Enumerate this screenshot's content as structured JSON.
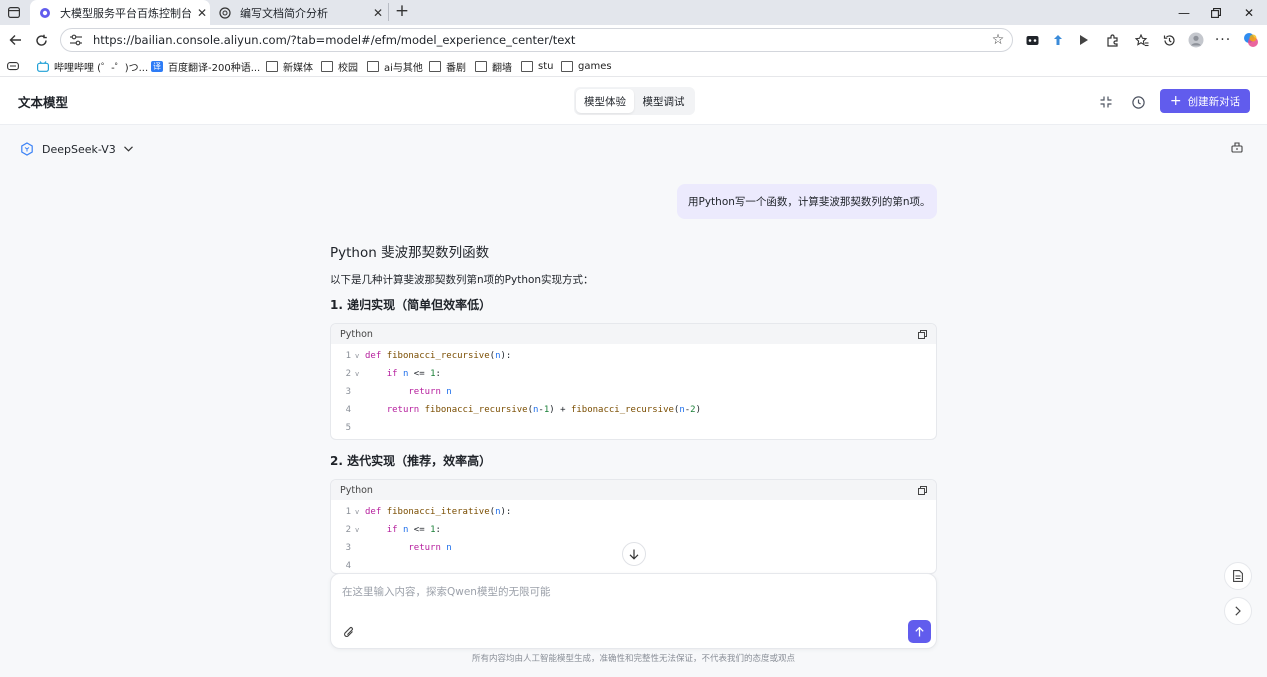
{
  "browser": {
    "tabs": [
      {
        "title": "大模型服务平台百炼控制台",
        "active": true
      },
      {
        "title": "编写文档简介分析",
        "active": false
      }
    ],
    "url": "https://bailian.console.aliyun.com/?tab=model#/efm/model_experience_center/text",
    "bookmarks": [
      "哔哩哔哩 (゜-゜)つ...",
      "百度翻译-200种语...",
      "新媒体",
      "校园",
      "ai与其他",
      "番剧",
      "翻墙",
      "stu",
      "games"
    ]
  },
  "app": {
    "title": "文本模型",
    "segments": [
      "模型体验",
      "模型调试"
    ],
    "active_segment": "模型体验",
    "new_chat": "创建新对话",
    "model_name": "DeepSeek-V3",
    "accent": "#615ced"
  },
  "chat": {
    "user_message": "用Python写一个函数，计算斐波那契数列的第n项。",
    "answer_title": "Python 斐波那契数列函数",
    "answer_intro": "以下是几种计算斐波那契数列第n项的Python实现方式：",
    "section1": "1. 递归实现（简单但效率低）",
    "section2": "2. 迭代实现（推荐，效率高）",
    "code1_lang": "Python",
    "code2_lang": "Python",
    "code1": [
      {
        "no": "1",
        "fold": "v",
        "tokens": [
          [
            "kw",
            "def "
          ],
          [
            "fn",
            "fibonacci_recursive"
          ],
          [
            "plain",
            "("
          ],
          [
            "vr",
            "n"
          ],
          [
            "plain",
            "):"
          ]
        ]
      },
      {
        "no": "2",
        "fold": "v",
        "tokens": [
          [
            "plain",
            "    "
          ],
          [
            "kw",
            "if "
          ],
          [
            "vr",
            "n"
          ],
          [
            "plain",
            " <= "
          ],
          [
            "nm",
            "1"
          ],
          [
            "plain",
            ":"
          ]
        ]
      },
      {
        "no": "3",
        "fold": "",
        "tokens": [
          [
            "plain",
            "        "
          ],
          [
            "kw",
            "return "
          ],
          [
            "vr",
            "n"
          ]
        ]
      },
      {
        "no": "4",
        "fold": "",
        "tokens": [
          [
            "plain",
            "    "
          ],
          [
            "kw",
            "return "
          ],
          [
            "fn",
            "fibonacci_recursive"
          ],
          [
            "plain",
            "("
          ],
          [
            "vr",
            "n"
          ],
          [
            "plain",
            "-"
          ],
          [
            "nm",
            "1"
          ],
          [
            "plain",
            ") + "
          ],
          [
            "fn",
            "fibonacci_recursive"
          ],
          [
            "plain",
            "("
          ],
          [
            "vr",
            "n"
          ],
          [
            "plain",
            "-"
          ],
          [
            "nm",
            "2"
          ],
          [
            "plain",
            ")"
          ]
        ]
      },
      {
        "no": "5",
        "fold": "",
        "tokens": []
      }
    ],
    "code2": [
      {
        "no": "1",
        "fold": "v",
        "tokens": [
          [
            "kw",
            "def "
          ],
          [
            "fn",
            "fibonacci_iterative"
          ],
          [
            "plain",
            "("
          ],
          [
            "vr",
            "n"
          ],
          [
            "plain",
            "):"
          ]
        ]
      },
      {
        "no": "2",
        "fold": "v",
        "tokens": [
          [
            "plain",
            "    "
          ],
          [
            "kw",
            "if "
          ],
          [
            "vr",
            "n"
          ],
          [
            "plain",
            " <= "
          ],
          [
            "nm",
            "1"
          ],
          [
            "plain",
            ":"
          ]
        ]
      },
      {
        "no": "3",
        "fold": "",
        "tokens": [
          [
            "plain",
            "        "
          ],
          [
            "kw",
            "return "
          ],
          [
            "vr",
            "n"
          ]
        ]
      },
      {
        "no": "4",
        "fold": "",
        "tokens": []
      }
    ],
    "input_placeholder": "在这里输入内容，探索Qwen模型的无限可能",
    "disclaimer": "所有内容均由人工智能模型生成，准确性和完整性无法保证，不代表我们的态度或观点"
  }
}
